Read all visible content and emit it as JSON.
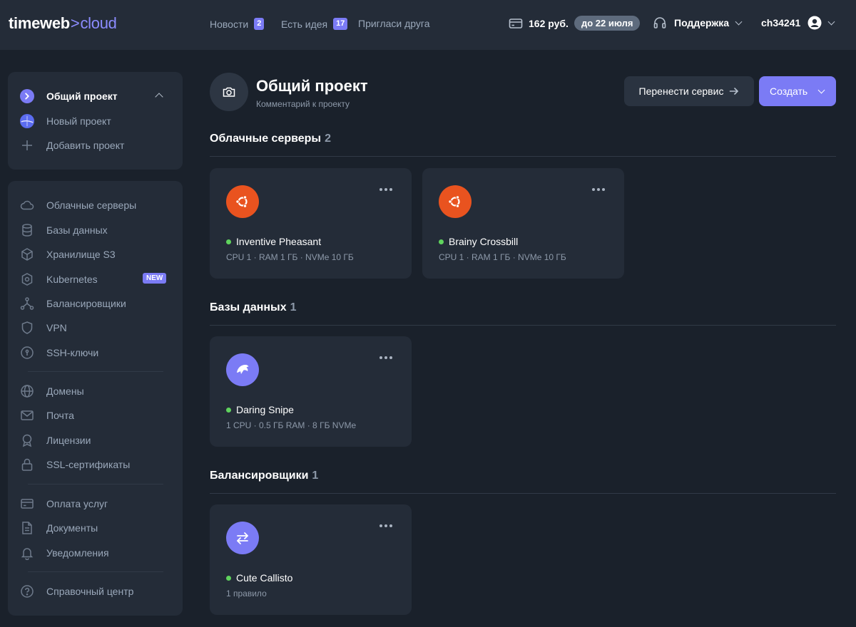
{
  "header": {
    "logo_main": "timeweb",
    "logo_sep": ">",
    "logo_accent": "cloud",
    "nav": [
      {
        "label": "Новости",
        "badge": "2"
      },
      {
        "label": "Есть идея",
        "badge": "17"
      },
      {
        "label": "Пригласи друга"
      }
    ],
    "balance": "162 руб.",
    "until": "до 22 июля",
    "support": "Поддержка",
    "user": "ch34241"
  },
  "sidebar": {
    "projects": [
      {
        "label": "Общий проект",
        "icon": "chevron-right-circle-icon"
      },
      {
        "label": "Новый проект",
        "icon": "project-avatar-icon"
      },
      {
        "label": "Добавить проект",
        "icon": "plus-icon"
      }
    ],
    "items": [
      {
        "label": "Облачные серверы",
        "icon": "cloud-icon"
      },
      {
        "label": "Базы данных",
        "icon": "database-icon"
      },
      {
        "label": "Хранилище S3",
        "icon": "cube-icon"
      },
      {
        "label": "Kubernetes",
        "icon": "kubernetes-icon",
        "badge": "NEW"
      },
      {
        "label": "Балансировщики",
        "icon": "balancer-icon"
      },
      {
        "label": "VPN",
        "icon": "shield-icon"
      },
      {
        "label": "SSH-ключи",
        "icon": "key-icon"
      },
      {
        "label": "Домены",
        "icon": "globe-icon"
      },
      {
        "label": "Почта",
        "icon": "mail-icon"
      },
      {
        "label": "Лицензии",
        "icon": "license-icon"
      },
      {
        "label": "SSL-сертификаты",
        "icon": "lock-icon"
      },
      {
        "label": "Оплата услуг",
        "icon": "card-icon"
      },
      {
        "label": "Документы",
        "icon": "document-icon"
      },
      {
        "label": "Уведомления",
        "icon": "bell-icon"
      },
      {
        "label": "Справочный центр",
        "icon": "help-icon"
      }
    ]
  },
  "main": {
    "title": "Общий проект",
    "comment": "Комментарий к проекту",
    "move_button": "Перенести сервис",
    "create_button": "Создать",
    "sections": [
      {
        "title": "Облачные серверы",
        "count": "2",
        "cards": [
          {
            "name": "Inventive Pheasant",
            "spec": "CPU 1 · RAM 1 ГБ · NVMe 10 ГБ",
            "icon": "ubuntu-icon"
          },
          {
            "name": "Brainy Crossbill",
            "spec": "CPU 1 · RAM 1 ГБ · NVMe 10 ГБ",
            "icon": "ubuntu-icon"
          }
        ]
      },
      {
        "title": "Базы данных",
        "count": "1",
        "cards": [
          {
            "name": "Daring Snipe",
            "spec": "1 CPU · 0.5 ГБ RAM · 8 ГБ NVMe",
            "icon": "dolphin-icon"
          }
        ]
      },
      {
        "title": "Балансировщики",
        "count": "1",
        "cards": [
          {
            "name": "Cute Callisto",
            "spec": "1 правило",
            "icon": "arrows-swap-icon"
          }
        ]
      }
    ]
  },
  "colors": {
    "accent": "#7b7bf5",
    "ubuntu": "#e9531f",
    "status": "#5fd35d"
  }
}
